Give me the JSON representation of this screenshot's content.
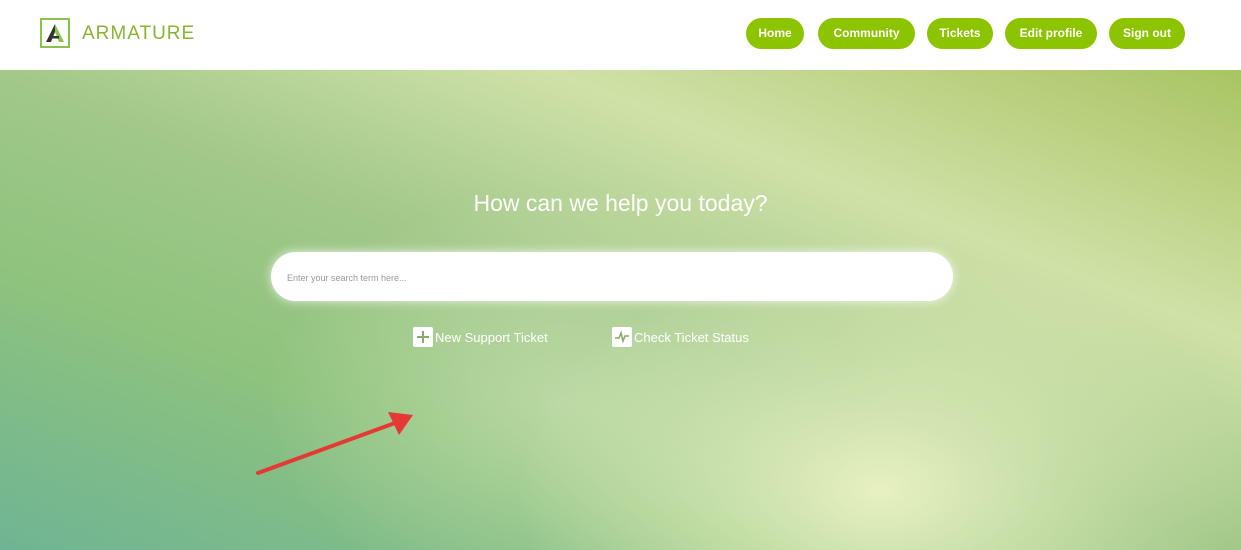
{
  "header": {
    "logo_text": "ARMATURE",
    "nav": [
      {
        "label": "Home"
      },
      {
        "label": "Community"
      },
      {
        "label": "Tickets"
      },
      {
        "label": "Edit profile"
      },
      {
        "label": "Sign out"
      }
    ]
  },
  "hero": {
    "title": "How can we help you today?",
    "search": {
      "placeholder": "Enter your search term here...",
      "value": ""
    },
    "actions": [
      {
        "label": "New Support Ticket",
        "icon": "plus-icon"
      },
      {
        "label": "Check Ticket Status",
        "icon": "pulse-icon"
      }
    ]
  },
  "annotation": {
    "arrow_color": "#e53935"
  },
  "colors": {
    "accent": "#8cc400",
    "logo": "#86b532"
  }
}
